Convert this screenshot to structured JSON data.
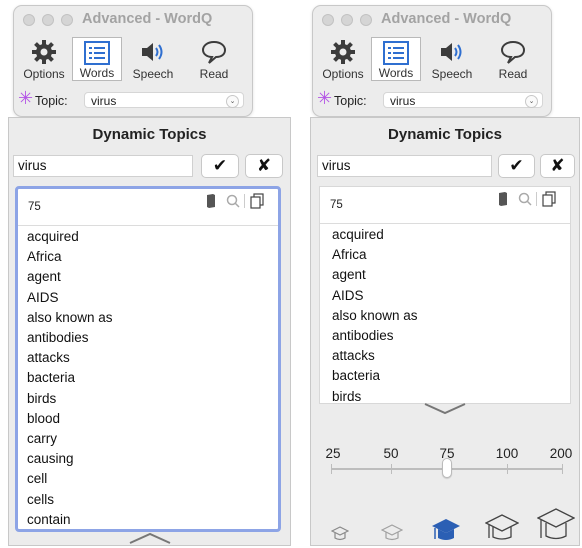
{
  "window": {
    "title": "Advanced - WordQ"
  },
  "toolbar": {
    "items": [
      {
        "label": "Options",
        "icon": "gear-icon"
      },
      {
        "label": "Words",
        "icon": "list-icon",
        "active": true
      },
      {
        "label": "Speech",
        "icon": "speaker-icon"
      },
      {
        "label": "Read",
        "icon": "speech-bubble-icon"
      }
    ]
  },
  "topic": {
    "label": "Topic:",
    "value": "virus"
  },
  "dynamic_topics": {
    "title": "Dynamic Topics",
    "search_value": "virus",
    "confirm_symbol": "✔",
    "cancel_symbol": "✘",
    "count": "75"
  },
  "words_left": [
    "acquired",
    "Africa",
    "agent",
    "AIDS",
    "also known as",
    "antibodies",
    "attacks",
    "bacteria",
    "birds",
    "blood",
    "carry",
    "causing",
    "cell",
    "cells",
    "contain"
  ],
  "words_right": [
    "acquired",
    "Africa",
    "agent",
    "AIDS",
    "also known as",
    "antibodies",
    "attacks",
    "bacteria",
    "birds"
  ],
  "slider": {
    "labels": [
      "25",
      "50",
      "75",
      "100",
      "200"
    ],
    "selected": "75"
  },
  "colors": {
    "accent_border": "#8da4e6",
    "topic_star": "#b354e6",
    "icon_blue": "#2f6fd0",
    "cap_selected": "#2b5fb4"
  }
}
